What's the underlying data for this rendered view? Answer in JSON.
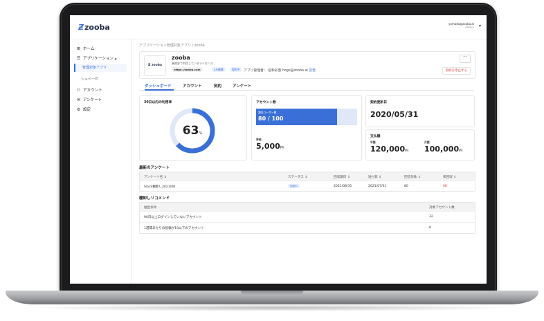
{
  "header": {
    "logo_mark": "Ƶ",
    "logo": "zooba",
    "user_email": "yamada@zooba.ai",
    "user_role": "Admin",
    "caret": "▾"
  },
  "sidebar": {
    "home": "ホーム",
    "applications": "アプリケーション",
    "applications_caret": "▴",
    "managed_apps": "管理対象アプリ",
    "shadow_it": "シャドーIT",
    "accounts": "アカウント",
    "surveys": "アンケート",
    "settings": "設定"
  },
  "breadcrumb": "アプリケーション管理対象アプリ / zooba",
  "app": {
    "logo_text": "Ƶ zooba",
    "name": "zooba",
    "description": "業務部で利用しているライセンス",
    "url": "https://zooba.com",
    "chip1": "API連携",
    "chip2": "契約中",
    "admin": "アプリ管理者： 名和彩音 hoge@zooba.ai",
    "change": "変更",
    "more": "···",
    "stop": "契約を停止する"
  },
  "tabs": [
    "ダッシュボード",
    "アカウント",
    "契約",
    "アンケート"
  ],
  "usage": {
    "title": "30日以内の利用率",
    "value": 63,
    "unit": "%"
  },
  "accounts": {
    "title": "アカウント数",
    "bar_label": "課金ユーザー数",
    "used": 80,
    "total": 100,
    "display": "80 / 100",
    "unit_price_label": "単価",
    "unit_price": "5,000",
    "yen": "円"
  },
  "renewal": {
    "title": "契約更新日",
    "date": "2020/05/31"
  },
  "payment": {
    "title": "支払額",
    "annual_label": "年額",
    "annual": "120,000",
    "monthly_label": "月額",
    "monthly": "100,000",
    "yen": "円"
  },
  "surveys": {
    "title": "最新のアンケート",
    "headers": [
      "アンケート名 ⇕",
      "ステータス ⇕",
      "回収期日 ⇕",
      "送付日 ⇕",
      "回答対象 ⇕",
      "未回収 ⇕"
    ],
    "rows": [
      {
        "name": "Slack棚卸し2021/08",
        "status": "回収中",
        "due": "2021/08/31",
        "sent": "2021/07/31",
        "targets": "80",
        "pending": "68"
      }
    ]
  },
  "recommend": {
    "title": "棚卸しリコメンド",
    "headers": [
      "抽出条件",
      "対象アカウント数"
    ],
    "rows": [
      {
        "condition": "90日以上ログインしていないアカウント",
        "count": "32"
      },
      {
        "condition": "1週間あたりの投稿が10以下のアカウント",
        "count": "8"
      }
    ]
  },
  "colors": {
    "accent": "#3a6fd8",
    "danger": "#e04646",
    "track": "#dfe7f8"
  }
}
